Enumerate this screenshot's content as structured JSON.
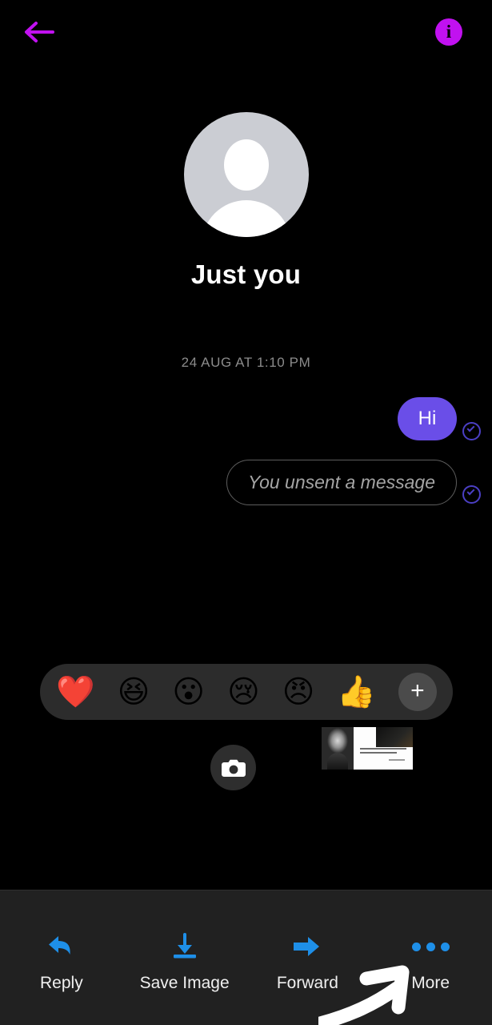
{
  "app": {
    "theme_background": "#000000",
    "accent_purple": "#6a4ee8",
    "accent_magenta": "#c111f0",
    "accent_blue": "#1e8fe8"
  },
  "topbar": {
    "back_icon": "arrow-left-icon",
    "back_label": "Back",
    "info_icon": "info-circle-icon",
    "info_label": "i"
  },
  "profile": {
    "avatar_icon": "default-person-avatar",
    "name": "Just you"
  },
  "conversation": {
    "timestamp": "24 AUG AT 1:10 PM",
    "messages": [
      {
        "text": "Hi",
        "type": "sent",
        "status_icon": "check-circle-icon"
      },
      {
        "text": "You unsent a message",
        "type": "unsent",
        "status_icon": "check-circle-icon"
      }
    ]
  },
  "reaction_bar": {
    "reactions": [
      {
        "name": "heart-reaction",
        "glyph": "❤️",
        "label": "Love"
      },
      {
        "name": "laughing-reaction",
        "glyph": "😆",
        "label": "Haha"
      },
      {
        "name": "surprised-reaction",
        "glyph": "😮",
        "label": "Wow"
      },
      {
        "name": "sad-reaction",
        "glyph": "😢",
        "label": "Sad"
      },
      {
        "name": "angry-reaction",
        "glyph": "😠",
        "label": "Angry"
      },
      {
        "name": "thumbs-up-reaction",
        "glyph": "👍",
        "label": "Like"
      }
    ],
    "add_label": "+",
    "add_name": "add-reaction-button"
  },
  "composer": {
    "camera_icon": "camera-icon",
    "thumbnail_name": "photo-thumbnail"
  },
  "action_bar": {
    "actions": [
      {
        "label": "Reply",
        "icon": "reply-arrow-icon",
        "name": "reply-action"
      },
      {
        "label": "Save Image",
        "icon": "download-icon",
        "name": "save-image-action"
      },
      {
        "label": "Forward",
        "icon": "forward-arrow-icon",
        "name": "forward-action"
      },
      {
        "label": "More",
        "icon": "more-dots-icon",
        "name": "more-action"
      }
    ]
  },
  "annotation": {
    "arrow_name": "annotation-arrow",
    "points_to": "More",
    "color": "#ffffff"
  }
}
